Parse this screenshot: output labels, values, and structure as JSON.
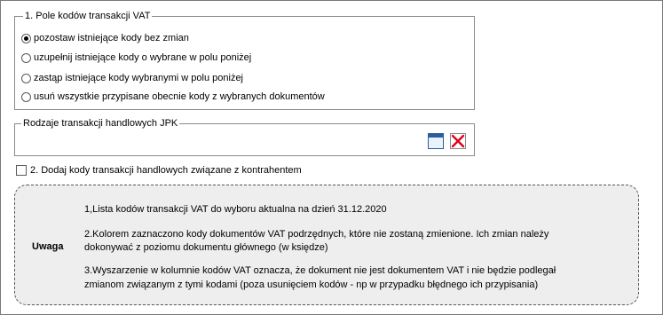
{
  "vat_codes": {
    "legend": "1.  Pole kodów transakcji VAT",
    "options": [
      {
        "label": "pozostaw istniejące kody bez zmian",
        "checked": true
      },
      {
        "label": "uzupełnij istniejące kody o wybrane w polu poniżej",
        "checked": false
      },
      {
        "label": "zastąp istniejące kody wybranymi w polu poniżej",
        "checked": false
      },
      {
        "label": "usuń wszystkie przypisane obecnie kody z wybranych dokumentów",
        "checked": false
      }
    ]
  },
  "jpk": {
    "legend": "Rodzaje transakcji handlowych JPK",
    "select_icon": "window-icon",
    "clear_icon": "close-icon"
  },
  "add_codes": {
    "label": "2. Dodaj kody transakcji handlowych związane z kontrahentem",
    "checked": false
  },
  "note": {
    "title": "Uwaga",
    "lines": [
      "1,Lista kodów transakcji VAT do wyboru aktualna na dzień 31.12.2020",
      "2.Kolorem zaznaczono kody dokumentów VAT podrzędnych, które nie zostaną zmienione. Ich zmian należy",
      "dokonywać z poziomu dokumentu głównego (w księdze)",
      "3.Wyszarzenie w kolumnie kodów VAT oznacza, że dokument nie jest dokumentem VAT i nie będzie podlegał",
      "zmianom związanym z tymi kodami (poza usunięciem kodów - np w przypadku błędnego ich przypisania)"
    ]
  },
  "colors": {
    "note_background": "#eeeeee",
    "close_icon": "#e0001b",
    "window_icon": "#2a5e9c"
  }
}
